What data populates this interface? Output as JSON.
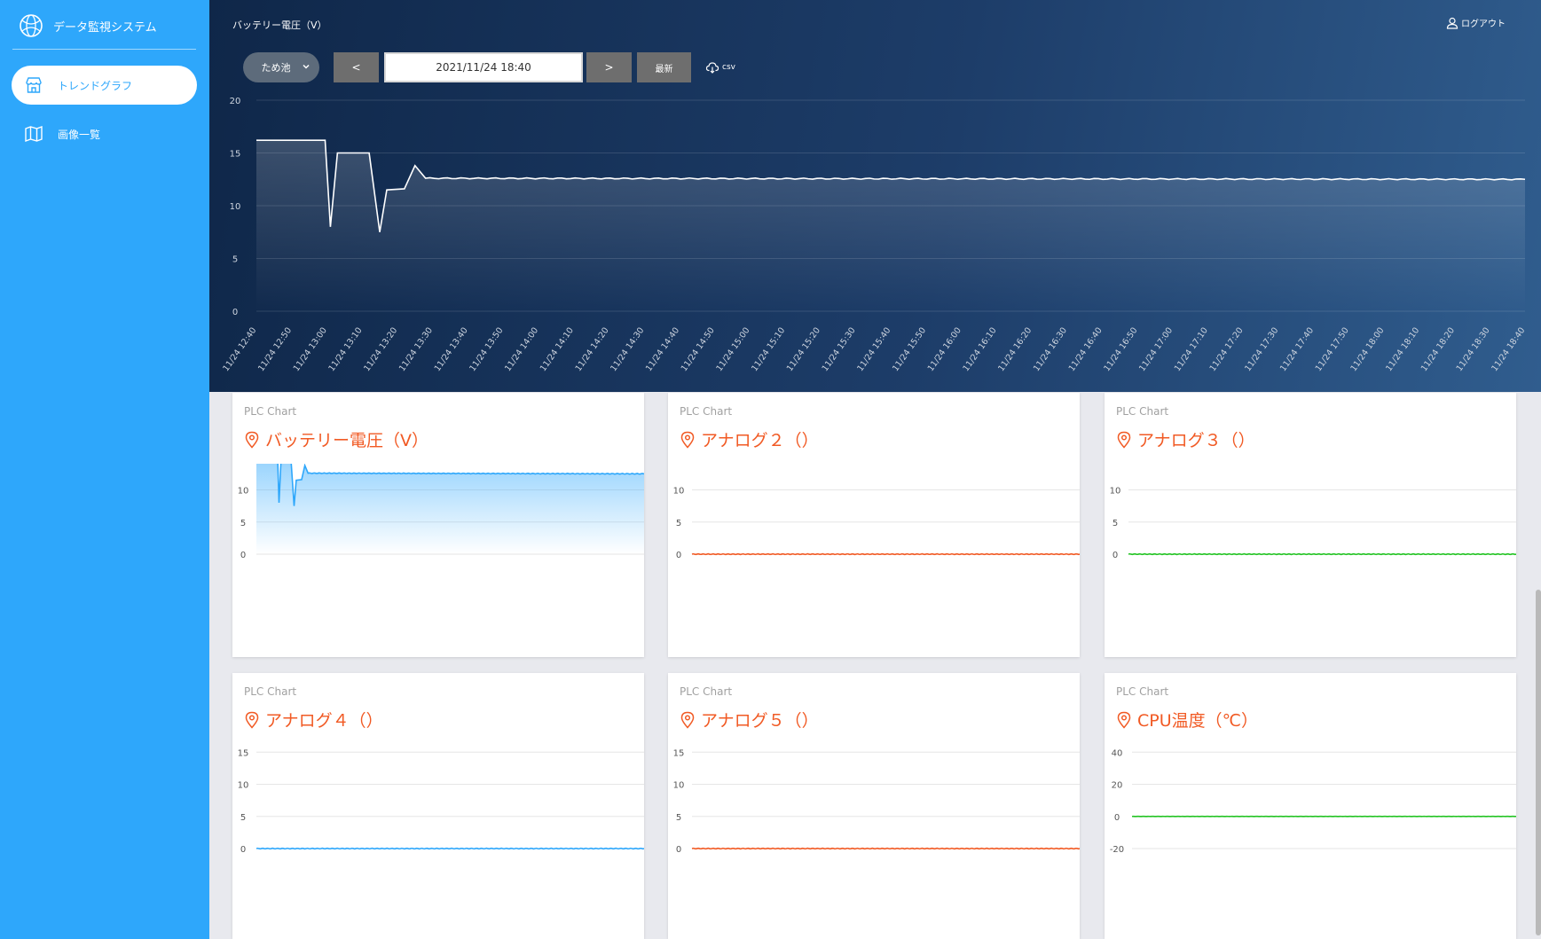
{
  "app": {
    "title": "データ監視システム"
  },
  "sidebar": {
    "items": [
      {
        "label": "トレンドグラフ",
        "icon": "store-icon",
        "active": true
      },
      {
        "label": "画像一覧",
        "icon": "map-icon",
        "active": false
      }
    ]
  },
  "header": {
    "title": "バッテリー電圧（V）",
    "logout_label": "ログアウト"
  },
  "toolbar": {
    "site_select": "ため池",
    "prev_label": "<",
    "date_value": "2021/11/24 18:40",
    "next_label": ">",
    "latest_label": "最新",
    "csv_label": "csv"
  },
  "colors": {
    "sidebar": "#2ea7fb",
    "accent_orange": "#f15a24",
    "line_blue": "#2ea7fb",
    "line_green": "#22c322",
    "line_white": "#ffffff"
  },
  "cards_subtitle": "PLC Chart",
  "chart_data": [
    {
      "id": "main",
      "type": "area",
      "x_labels": [
        "11/24 12:40",
        "11/24 12:50",
        "11/24 13:00",
        "11/24 13:10",
        "11/24 13:20",
        "11/24 13:30",
        "11/24 13:40",
        "11/24 13:50",
        "11/24 14:00",
        "11/24 14:10",
        "11/24 14:20",
        "11/24 14:30",
        "11/24 14:40",
        "11/24 14:50",
        "11/24 15:00",
        "11/24 15:10",
        "11/24 15:20",
        "11/24 15:30",
        "11/24 15:40",
        "11/24 15:50",
        "11/24 16:00",
        "11/24 16:10",
        "11/24 16:20",
        "11/24 16:30",
        "11/24 16:40",
        "11/24 16:50",
        "11/24 17:00",
        "11/24 17:10",
        "11/24 17:20",
        "11/24 17:30",
        "11/24 17:40",
        "11/24 17:50",
        "11/24 18:00",
        "11/24 18:10",
        "11/24 18:20",
        "11/24 18:30",
        "11/24 18:40"
      ],
      "ylim": [
        0,
        20
      ],
      "yticks": [
        0,
        5,
        10,
        15,
        20
      ],
      "grid": true,
      "color": "#ffffff",
      "points": [
        [
          0,
          16.2
        ],
        [
          1.95,
          16.2
        ],
        [
          2.1,
          8.0
        ],
        [
          2.3,
          15.0
        ],
        [
          3.2,
          15.0
        ],
        [
          3.5,
          7.5
        ],
        [
          3.7,
          11.5
        ],
        [
          4.2,
          11.6
        ],
        [
          4.5,
          13.8
        ],
        [
          4.8,
          12.6
        ],
        [
          36,
          12.5
        ]
      ]
    },
    {
      "id": "battery",
      "title": "バッテリー電圧（V）",
      "type": "area",
      "ylim": [
        0,
        20
      ],
      "yticks": [
        0,
        5,
        10,
        15,
        20
      ],
      "grid": true,
      "color": "#2ea7fb",
      "points": [
        [
          0,
          16.2
        ],
        [
          1.95,
          16.2
        ],
        [
          2.1,
          8.0
        ],
        [
          2.3,
          15.0
        ],
        [
          3.2,
          15.0
        ],
        [
          3.5,
          7.5
        ],
        [
          3.7,
          11.5
        ],
        [
          4.2,
          11.6
        ],
        [
          4.5,
          13.8
        ],
        [
          4.8,
          12.6
        ],
        [
          36,
          12.5
        ]
      ]
    },
    {
      "id": "analog2",
      "title": "アナログ２（）",
      "type": "line",
      "ylim": [
        0,
        20
      ],
      "yticks": [
        0,
        5,
        10,
        15,
        20
      ],
      "grid": true,
      "color": "#f15a24",
      "points": [
        [
          0,
          0
        ],
        [
          36,
          0
        ]
      ]
    },
    {
      "id": "analog3",
      "title": "アナログ３（）",
      "type": "line",
      "ylim": [
        0,
        20
      ],
      "yticks": [
        0,
        5,
        10,
        15,
        20
      ],
      "grid": true,
      "color": "#22c322",
      "points": [
        [
          0,
          0
        ],
        [
          36,
          0
        ]
      ]
    },
    {
      "id": "analog4",
      "title": "アナログ４（）",
      "type": "line",
      "ylim": [
        0,
        20
      ],
      "yticks": [
        0,
        5,
        10,
        15,
        20
      ],
      "grid": true,
      "color": "#2ea7fb",
      "points": [
        [
          0,
          0
        ],
        [
          36,
          0
        ]
      ]
    },
    {
      "id": "analog5",
      "title": "アナログ５（）",
      "type": "line",
      "ylim": [
        0,
        20
      ],
      "yticks": [
        0,
        5,
        10,
        15,
        20
      ],
      "grid": true,
      "color": "#f15a24",
      "points": [
        [
          0,
          0
        ],
        [
          36,
          0
        ]
      ]
    },
    {
      "id": "cpu",
      "title": "CPU温度（℃）",
      "type": "line",
      "ylim": [
        -20,
        60
      ],
      "yticks": [
        -20,
        0,
        20,
        40,
        60
      ],
      "grid": true,
      "color": "#22c322",
      "points": [
        [
          0,
          0
        ],
        [
          36,
          0
        ]
      ]
    }
  ]
}
